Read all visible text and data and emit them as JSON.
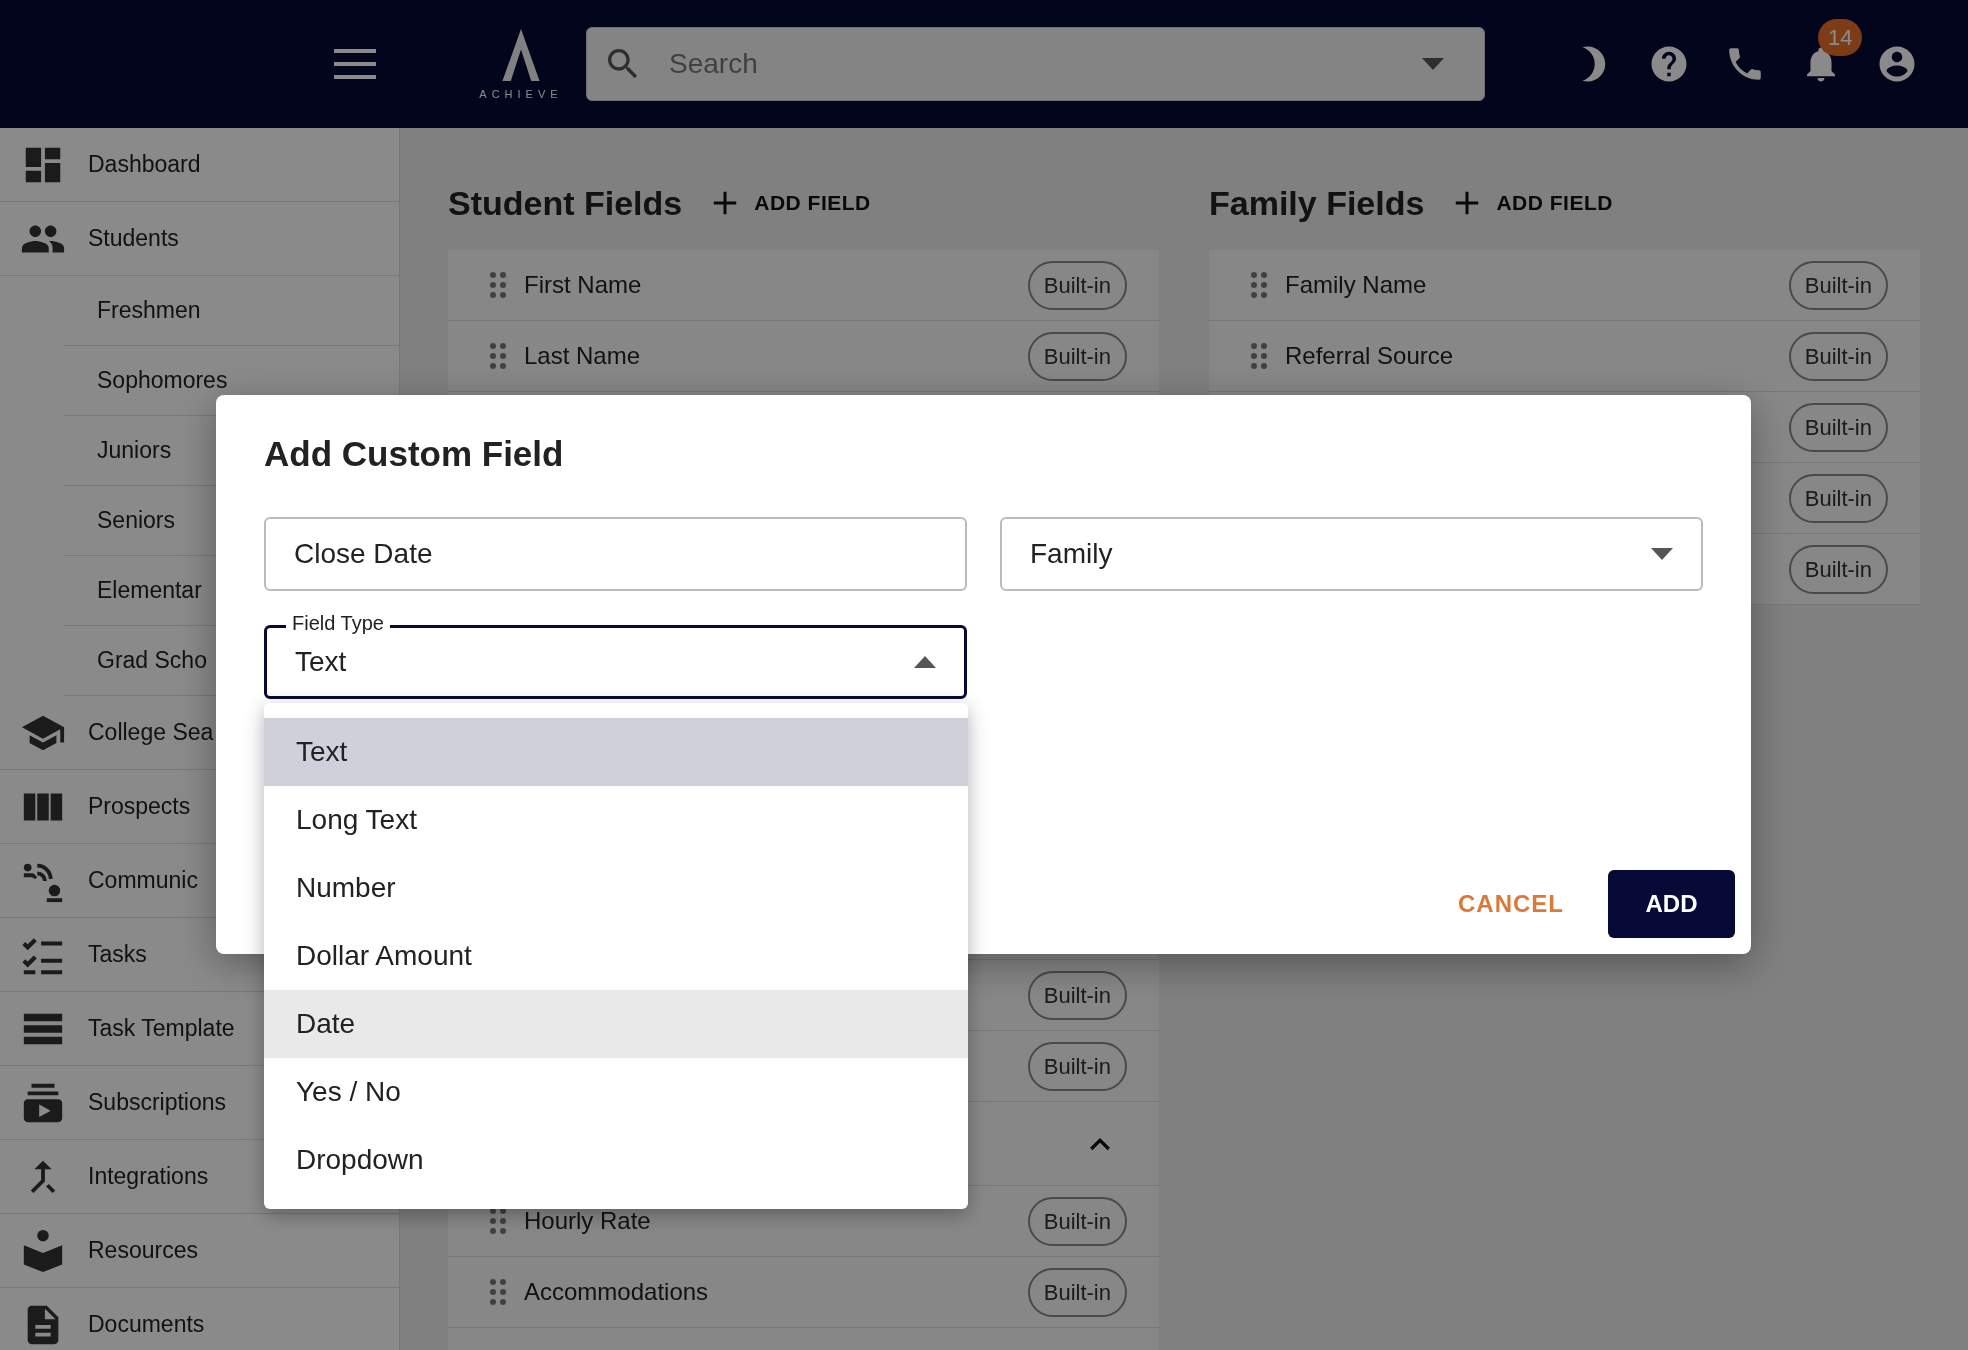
{
  "topbar": {
    "logo_text": "ACHIEVE",
    "search": {
      "placeholder": "Search"
    },
    "notification_count": "14"
  },
  "sidebar": {
    "items": [
      {
        "label": "Dashboard"
      },
      {
        "label": "Students",
        "expanded": true,
        "children": [
          {
            "label": "Freshmen"
          },
          {
            "label": "Sophomores"
          },
          {
            "label": "Juniors"
          },
          {
            "label": "Seniors"
          },
          {
            "label": "Elementar"
          },
          {
            "label": "Grad Scho"
          }
        ]
      },
      {
        "label": "College Sea"
      },
      {
        "label": "Prospects"
      },
      {
        "label": "Communic"
      },
      {
        "label": "Tasks"
      },
      {
        "label": "Task Template"
      },
      {
        "label": "Subscriptions"
      },
      {
        "label": "Integrations"
      },
      {
        "label": "Resources"
      },
      {
        "label": "Documents"
      }
    ]
  },
  "student_fields": {
    "title": "Student Fields",
    "add_label": "ADD FIELD",
    "rows": [
      {
        "kind": "field",
        "name": "First Name",
        "badge": "Built-in"
      },
      {
        "kind": "field",
        "name": "Last Name",
        "badge": "Built-in"
      }
    ],
    "rows_below_dialog": [
      {
        "kind": "field",
        "badge": "Built-in"
      },
      {
        "kind": "field",
        "badge": "Built-in"
      },
      {
        "kind": "group",
        "expanded": true
      },
      {
        "kind": "field",
        "name": "Hourly Rate",
        "badge": "Built-in"
      },
      {
        "kind": "field",
        "name": "Accommodations",
        "badge": "Built-in"
      }
    ]
  },
  "family_fields": {
    "title": "Family Fields",
    "add_label": "ADD FIELD",
    "rows": [
      {
        "kind": "field",
        "name": "Family Name",
        "badge": "Built-in"
      },
      {
        "kind": "field",
        "name": "Referral Source",
        "badge": "Built-in"
      },
      {
        "kind": "field",
        "badge": "Built-in"
      },
      {
        "kind": "field",
        "badge": "Built-in"
      },
      {
        "kind": "field",
        "badge": "Built-in"
      }
    ]
  },
  "dialog": {
    "title": "Add Custom Field",
    "field_label": {
      "value": "Close Date"
    },
    "applies_to": {
      "value": "Family",
      "open": false
    },
    "field_type": {
      "label": "Field Type",
      "value": "Text",
      "open": true,
      "options": [
        {
          "label": "Text",
          "selected": true,
          "hovered": false
        },
        {
          "label": "Long Text",
          "selected": false,
          "hovered": false
        },
        {
          "label": "Number",
          "selected": false,
          "hovered": false
        },
        {
          "label": "Dollar Amount",
          "selected": false,
          "hovered": false
        },
        {
          "label": "Date",
          "selected": false,
          "hovered": true
        },
        {
          "label": "Yes / No",
          "selected": false,
          "hovered": false
        },
        {
          "label": "Dropdown",
          "selected": false,
          "hovered": false
        }
      ]
    },
    "buttons": [
      {
        "label": "CANCEL",
        "kind": "text"
      },
      {
        "label": "ADD",
        "kind": "primary"
      }
    ]
  }
}
